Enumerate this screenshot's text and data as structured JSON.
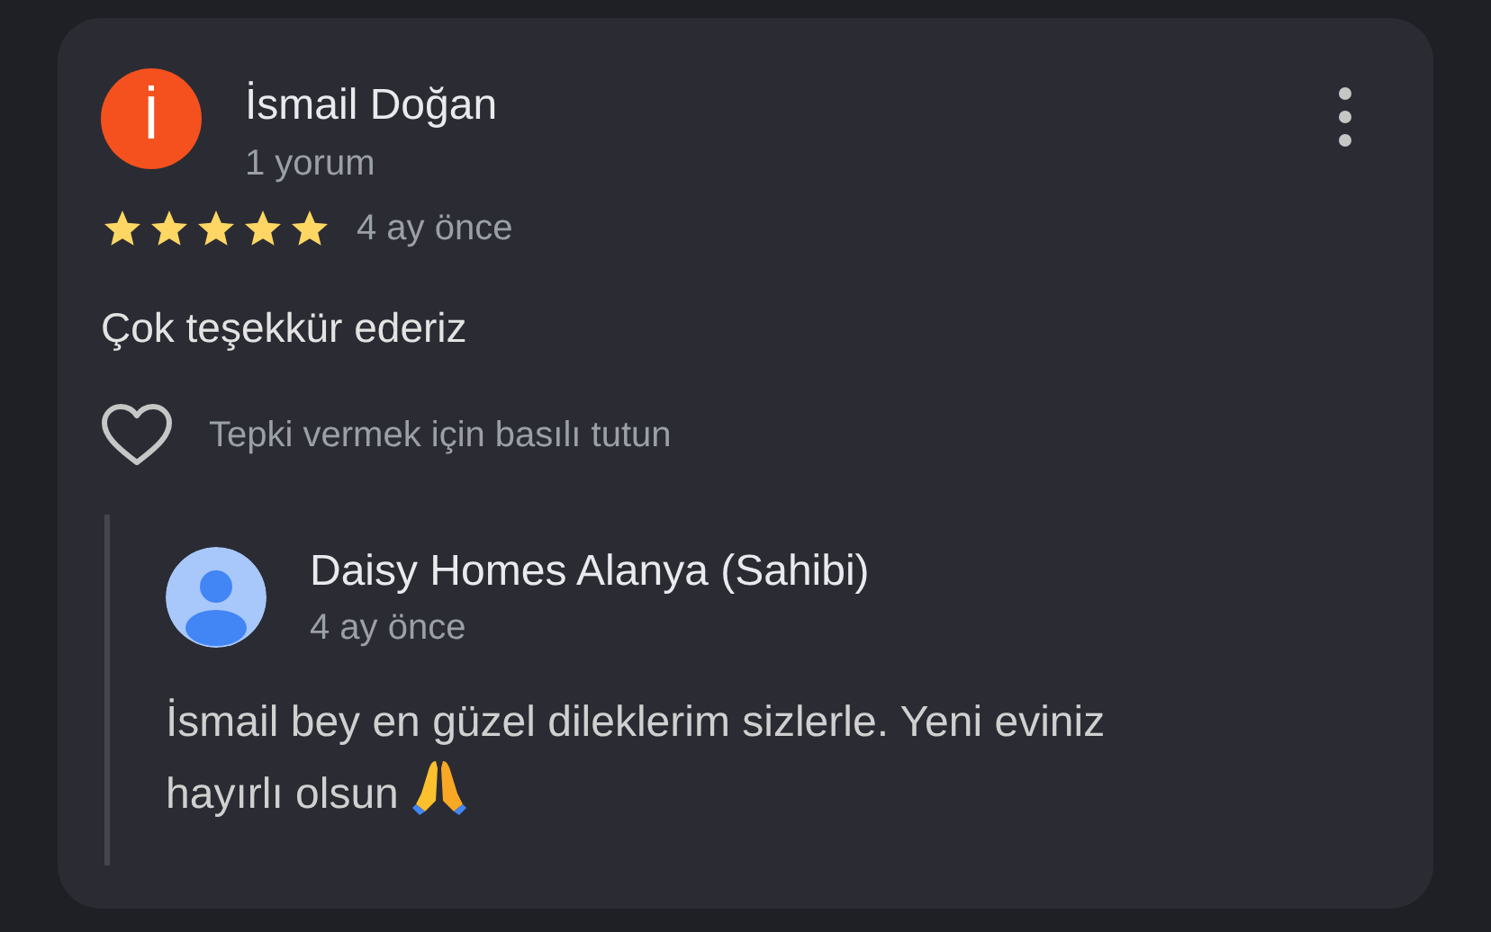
{
  "review": {
    "avatar_letter": "İ",
    "author": "İsmail Doğan",
    "meta": "1 yorum",
    "stars": 5,
    "time": "4 ay önce",
    "text": "Çok teşekkür ederiz",
    "reaction_hint": "Tepki vermek için basılı tutun"
  },
  "reply": {
    "author": "Daisy Homes Alanya (Sahibi)",
    "time": "4 ay önce",
    "text_lines": [
      "İsmail bey en güzel dileklerim sizlerle. Yeni eviniz",
      "hayırlı olsun"
    ]
  }
}
